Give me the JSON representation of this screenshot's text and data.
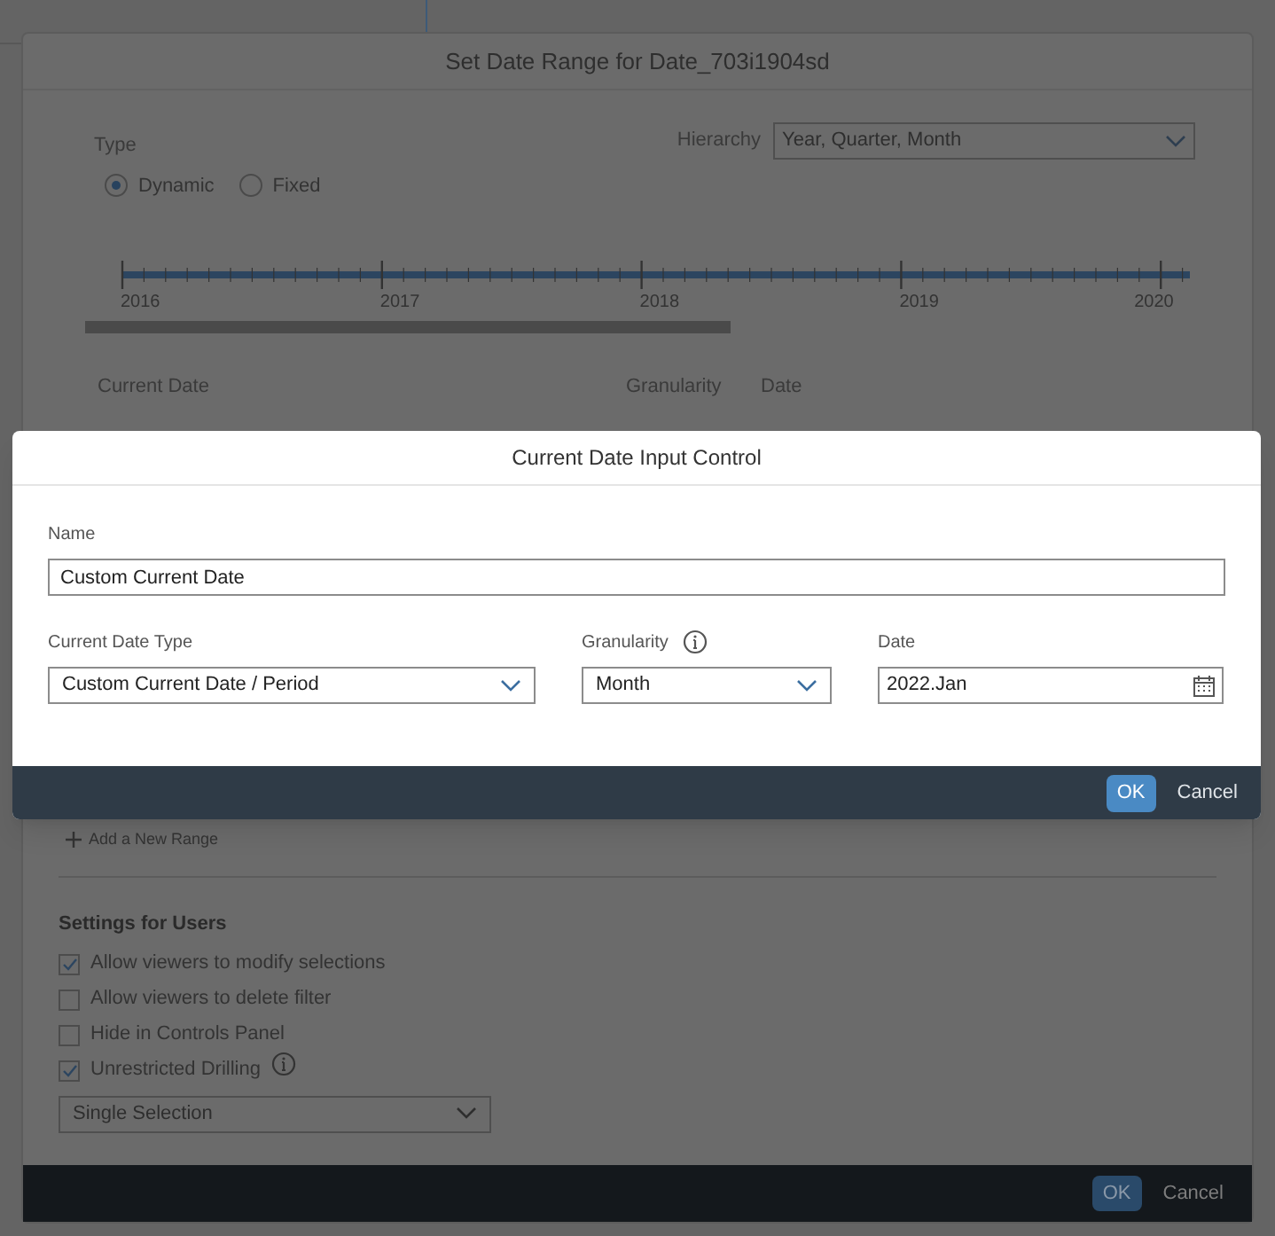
{
  "background_dialog": {
    "title": "Set Date Range for Date_703i1904sd",
    "type": {
      "label": "Type",
      "options": [
        {
          "label": "Dynamic",
          "selected": true
        },
        {
          "label": "Fixed",
          "selected": false
        }
      ]
    },
    "hierarchy": {
      "label": "Hierarchy",
      "value": "Year, Quarter, Month"
    },
    "timeline": {
      "years": [
        "2016",
        "2017",
        "2018",
        "2019",
        "2020"
      ]
    },
    "current_date_labels": [
      "Current Date",
      "Granularity",
      "Date"
    ],
    "add_range": "Add a New Range",
    "settings": {
      "title": "Settings for Users",
      "options": [
        {
          "label": "Allow viewers to modify selections",
          "checked": true,
          "info": false
        },
        {
          "label": "Allow viewers to delete filter",
          "checked": false,
          "info": false
        },
        {
          "label": "Hide in Controls Panel",
          "checked": false,
          "info": false
        },
        {
          "label": "Unrestricted Drilling",
          "checked": true,
          "info": true
        }
      ]
    },
    "selection_mode": "Single Selection",
    "buttons": [
      {
        "label": "OK",
        "kind": "primary"
      },
      {
        "label": "Cancel",
        "kind": "secondary"
      }
    ]
  },
  "dialog": {
    "title": "Current Date Input Control",
    "name": {
      "label": "Name",
      "value": "Custom Current Date"
    },
    "fields": [
      {
        "label": "Current Date Type",
        "value": "Custom Current Date / Period",
        "kind": "dropdown",
        "info": false
      },
      {
        "label": "Granularity",
        "value": "Month",
        "kind": "dropdown",
        "info": true
      },
      {
        "label": "Date",
        "value": "2022.Jan",
        "kind": "date",
        "info": false
      }
    ],
    "buttons": [
      {
        "label": "OK",
        "kind": "primary"
      },
      {
        "label": "Cancel",
        "kind": "secondary"
      }
    ]
  }
}
